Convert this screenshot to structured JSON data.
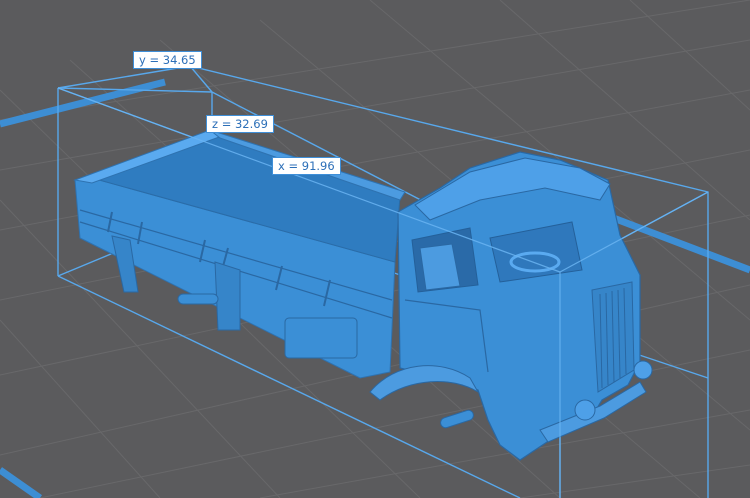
{
  "viewport": {
    "background_color": "#5b5b5d",
    "grid_color": "#6a6a6c",
    "bed_edge_color": "#3d8ed4",
    "bounding_box_color": "#56a6ea",
    "model_color": "#3b8fd6"
  },
  "dimensions": {
    "y_label": "y = 34.65",
    "z_label": "z = 32.69",
    "x_label": "x = 91.96"
  },
  "model": {
    "name_icon": "truck-model"
  }
}
